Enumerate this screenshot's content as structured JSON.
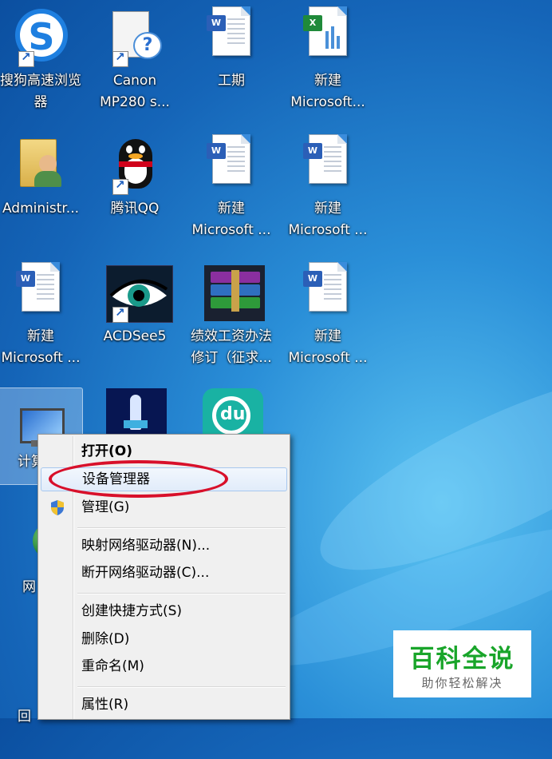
{
  "desktop": {
    "icons": [
      {
        "label_line1": "搜狗高速浏览",
        "label_line2": "器",
        "icon": "sogou-browser-icon"
      },
      {
        "label_line1": "Canon",
        "label_line2": "MP280 s...",
        "icon": "canon-printer-help-icon"
      },
      {
        "label_line1": "工期",
        "label_line2": "",
        "icon": "word-document-icon"
      },
      {
        "label_line1": "新建",
        "label_line2": "Microsoft...",
        "icon": "excel-document-icon"
      },
      {
        "label_line1": "Administr...",
        "label_line2": "",
        "icon": "user-folder-icon"
      },
      {
        "label_line1": "腾讯QQ",
        "label_line2": "",
        "icon": "qq-penguin-icon"
      },
      {
        "label_line1": "新建",
        "label_line2": "Microsoft ...",
        "icon": "word-document-icon"
      },
      {
        "label_line1": "新建",
        "label_line2": "Microsoft ...",
        "icon": "word-document-icon"
      },
      {
        "label_line1": "新建",
        "label_line2": "Microsoft ...",
        "icon": "word-document-icon"
      },
      {
        "label_line1": "ACDSee5",
        "label_line2": "",
        "icon": "acdsee-eye-icon"
      },
      {
        "label_line1": "绩效工资办法",
        "label_line2": "修订（征求...",
        "icon": "winrar-archive-icon"
      },
      {
        "label_line1": "新建",
        "label_line2": "Microsoft ...",
        "icon": "word-document-icon"
      },
      {
        "label_line1": "计算",
        "label_line2": "",
        "icon": "computer-icon"
      },
      {
        "label_line1": "网",
        "label_line2": "",
        "icon": "network-globe-icon"
      },
      {
        "label_line1": "回",
        "label_line2": "",
        "icon": "recycle-bin-icon"
      }
    ]
  },
  "context_menu": {
    "items": [
      {
        "label": "打开(O)"
      },
      {
        "label": "设备管理器"
      },
      {
        "label": "管理(G)"
      },
      {
        "label": "映射网络驱动器(N)..."
      },
      {
        "label": "断开网络驱动器(C)..."
      },
      {
        "label": "创建快捷方式(S)"
      },
      {
        "label": "删除(D)"
      },
      {
        "label": "重命名(M)"
      },
      {
        "label": "属性(R)"
      }
    ]
  },
  "watermark": {
    "title": "百科全说",
    "subtitle": "助你轻松解决"
  },
  "colors": {
    "highlight_ellipse": "#d8102a",
    "watermark_green": "#19a52a"
  }
}
